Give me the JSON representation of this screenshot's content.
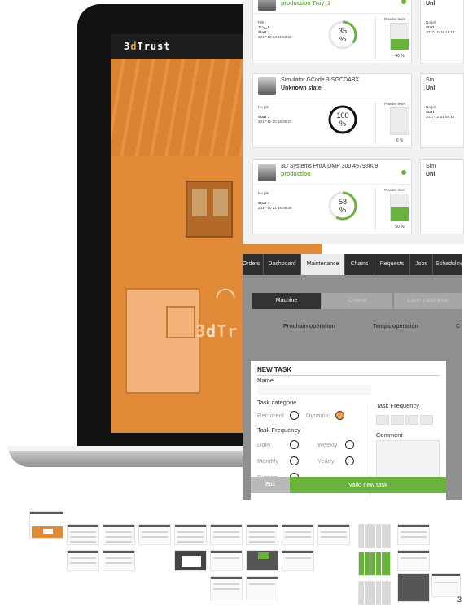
{
  "brand": {
    "prefix": "3",
    "accent": "d",
    "suffix": "Trust"
  },
  "screen_watermark": {
    "prefix": "3",
    "accent": "d",
    "suffix": "Tr"
  },
  "machines": [
    {
      "name": "",
      "state": "production Troy_1",
      "state_color": "green",
      "online": true,
      "info_line1": "File :",
      "info_line2": "Troy_1",
      "start_label": "Start :",
      "start": "2017-10-24 11:03:32",
      "progress": 35,
      "progress_text": "35",
      "progress_unit": "%",
      "powder_label": "Powder level",
      "powder_pct": 40,
      "powder_text": "40 %"
    },
    {
      "name": "Simulator GCode 3-SGCDABX",
      "state": "Unknown state",
      "state_color": "dark",
      "online": false,
      "info_line1": "No job",
      "info_line2": "",
      "start_label": "Start :",
      "start": "2017-11-20 16:40:23",
      "progress": 100,
      "progress_text": "100",
      "progress_unit": "%",
      "powder_label": "Powder level",
      "powder_pct": 0,
      "powder_text": "0 %"
    },
    {
      "name": "3D Systems ProX DMP 300 45798809",
      "state": "production",
      "state_color": "green",
      "online": true,
      "info_line1": "No job",
      "info_line2": "",
      "start_label": "Start :",
      "start": "2017-11-21 16:48:39",
      "progress": 58,
      "progress_text": "58",
      "progress_unit": "%",
      "powder_label": "Powder level",
      "powder_pct": 50,
      "powder_text": "50 %"
    }
  ],
  "side_cards": [
    {
      "t1": "",
      "t2": "Unl",
      "t3a": "No job",
      "t3b": "Start :",
      "t3c": "2017-10-18 18:13"
    },
    {
      "t1": "Sin",
      "t2": "Unl",
      "t3a": "No job",
      "t3b": "Start :",
      "t3c": "2017-11-21 09:18"
    },
    {
      "t1": "Sim",
      "t2": "Unl",
      "t3a": "",
      "t3b": "",
      "t3c": ""
    }
  ],
  "nav_tabs": [
    "Orders",
    "Dashboard",
    "Maintenance",
    "Chains",
    "Requests",
    "Jobs",
    "Scheduling"
  ],
  "active_tab": "Maintenance",
  "segments": [
    "Machine",
    "Chaine",
    "Laser calibration"
  ],
  "columns": [
    "Prochain opération",
    "Temps opération",
    "C"
  ],
  "modal": {
    "title": "NEW TASK",
    "name_label": "Name",
    "category_label": "Task catégorie",
    "recurrent": "Recurrent",
    "dynamic": "Dynamic",
    "frequency_label": "Task Frequency",
    "daily": "Daily",
    "weekly": "Weekly",
    "monthly": "Monthly",
    "yearly": "Yearly",
    "custom": "Custom",
    "right_frequency_label": "Task Frequency",
    "comment_label": "Comment",
    "cancel": "Edit",
    "submit": "Valid new task",
    "selected_category": "Dynamic"
  },
  "colors": {
    "accent_orange": "#f0a040",
    "green": "#6ab23e",
    "dark_nav": "#2f2f2f"
  },
  "page_number": "3"
}
